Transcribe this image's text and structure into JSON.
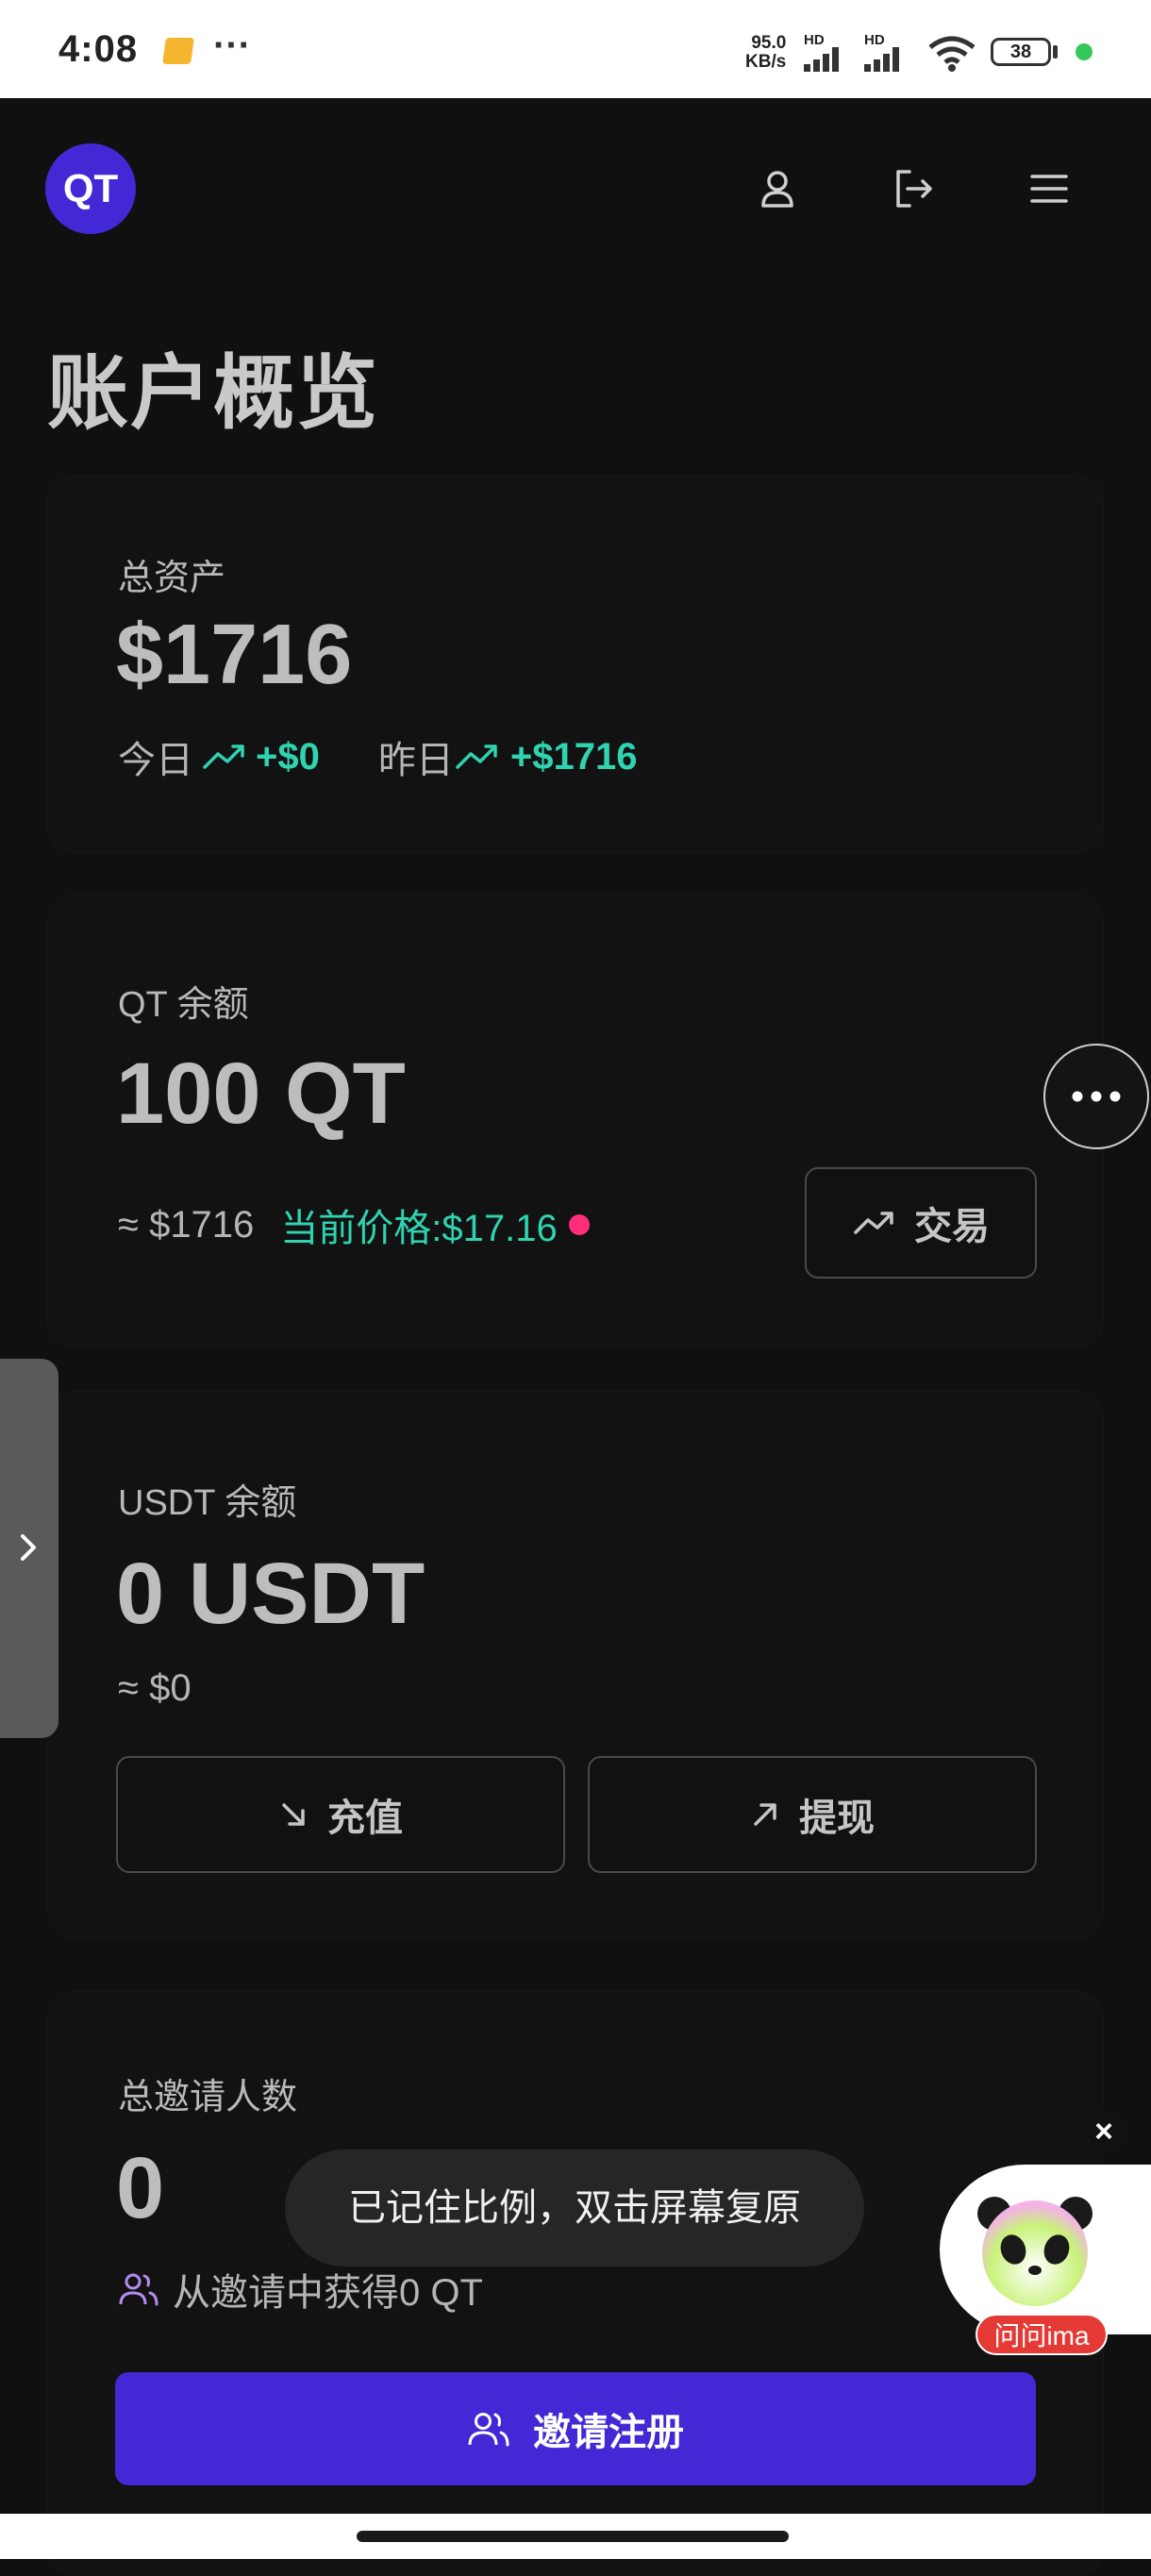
{
  "status_bar": {
    "time": "4:08",
    "net_speed_value": "95.0",
    "net_speed_unit": "KB/s",
    "hd1": "HD",
    "hd2": "HD",
    "battery": "38"
  },
  "header": {
    "logo": "QT",
    "icons": [
      "user-icon",
      "logout-icon",
      "menu-icon"
    ]
  },
  "page_title": "账户概览",
  "total_assets": {
    "label": "总资产",
    "value": "$1716",
    "today_label": "今日",
    "today_change": "+$0",
    "yesterday_label": "昨日",
    "yesterday_change": "+$1716"
  },
  "qt_balance": {
    "label": "QT 余额",
    "value": "100 QT",
    "approx": "≈ $1716",
    "price_text": "当前价格:$17.16",
    "trade_label": "交易"
  },
  "usdt_balance": {
    "label": "USDT 余额",
    "value": "0 USDT",
    "approx": "≈ $0",
    "deposit_label": "充值",
    "withdraw_label": "提现"
  },
  "invites": {
    "label": "总邀请人数",
    "value": "0",
    "earned_text": "从邀请中获得0 QT",
    "invite_button": "邀请注册"
  },
  "overlay": {
    "toast": "已记住比例，双击屏幕复原",
    "ima_tag": "问问ima"
  },
  "colors": {
    "accent": "#4328d6",
    "positive": "#2fd3b0",
    "price_dot": "#ff2d7a",
    "invite_icon": "#b38cf0"
  }
}
